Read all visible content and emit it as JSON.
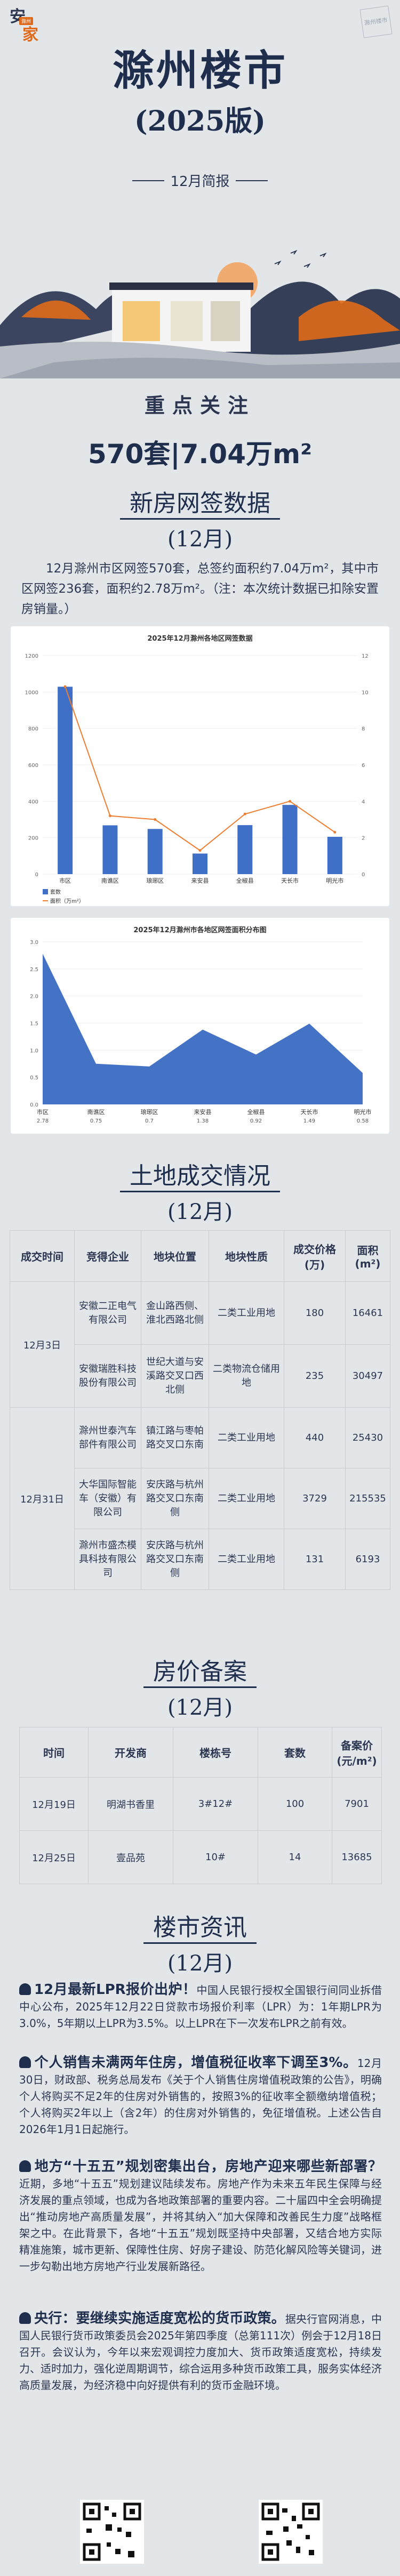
{
  "header": {
    "logo_char1": "安",
    "logo_char2": "家",
    "logo_sub": "滁州",
    "corner_logo": "滁州楼市",
    "title": "滁州楼市",
    "subtitle": "(2025版)",
    "brief": "12月简报",
    "focus": "重点关注",
    "headline": "570套|7.04万m²"
  },
  "newhouse": {
    "title": "新房网签数据",
    "period": "(12月)",
    "paragraph": "12月滁州市区网签570套，总签约面积约7.04万m²，其中市区网签236套，面积约2.78万m²。（注：本次统计数据已扣除安置房销量。）"
  },
  "chart_data": [
    {
      "type": "bar",
      "title": "2025年12月滁州各地区网签数据",
      "categories": [
        "市区",
        "南谯区",
        "琅琊区",
        "来安县",
        "全椒县",
        "天长市",
        "明光市"
      ],
      "series": [
        {
          "name": "套数",
          "values": [
            1029,
            268,
            248,
            113,
            269,
            380,
            205
          ]
        },
        {
          "name": "面积（万m²）",
          "values": [
            10.3,
            3.2,
            3.0,
            1.3,
            3.3,
            4.0,
            2.3
          ]
        }
      ],
      "legend": "bottom-left"
    },
    {
      "type": "area",
      "title": "2025年12月滁州市各地区网签面积分布图",
      "categories": [
        "市区",
        "南谯区",
        "琅琊区",
        "来安县",
        "全椒县",
        "天长市",
        "明光市"
      ],
      "values": [
        2.78,
        0.75,
        0.7,
        1.38,
        0.92,
        1.49,
        0.58
      ]
    }
  ],
  "land": {
    "title": "土地成交情况",
    "period": "(12月)",
    "headers": [
      "成交时间",
      "竞得企业",
      "地块位置",
      "地块性质",
      "成交价格(万)",
      "面积(m²)"
    ],
    "rows": [
      [
        "12月3日",
        "安徽二正电气有限公司",
        "金山路西侧、淮北西路北侧",
        "二类工业用地",
        "180",
        "16461"
      ],
      [
        "",
        "安徽瑞胜科技股份有限公司",
        "世纪大道与安溪路交叉口西北侧",
        "二类物流仓储用地",
        "235",
        "30497"
      ],
      [
        "12月31日",
        "滁州世泰汽车部件有限公司",
        "镇江路与枣帕路交叉口东南",
        "二类工业用地",
        "440",
        "25430"
      ],
      [
        "",
        "大华国际智能车（安徽）有限公司",
        "安庆路与杭州路交叉口东南侧",
        "二类工业用地",
        "3729",
        "215535"
      ],
      [
        "",
        "滁州市盛杰模具科技有限公司",
        "安庆路与杭州路交叉口东南侧",
        "二类工业用地",
        "131",
        "6193"
      ]
    ]
  },
  "filing": {
    "title": "房价备案",
    "period": "(12月)",
    "headers": [
      "时间",
      "开发商",
      "楼栋号",
      "套数",
      "备案价(元/m²)"
    ],
    "rows": [
      [
        "12月19日",
        "明湖书香里",
        "3#12#",
        "100",
        "7901"
      ],
      [
        "12月25日",
        "壹品苑",
        "10#",
        "14",
        "13685"
      ]
    ]
  },
  "news": {
    "title": "楼市资讯",
    "period": "(12月)",
    "items": [
      {
        "head": "12月最新LPR报价出炉！",
        "body": "中国人民银行授权全国银行间同业拆借中心公布，2025年12月22日贷款市场报价利率（LPR）为：1年期LPR为3.0%，5年期以上LPR为3.5%。以上LPR在下一次发布LPR之前有效。"
      },
      {
        "head": "个人销售未满两年住房，增值税征收率下调至3%。",
        "body": "12月30日，财政部、税务总局发布《关于个人销售住房增值税政策的公告》，明确个人将购买不足2年的住房对外销售的，按照3%的征收率全额缴纳增值税；个人将购买2年以上（含2年）的住房对外销售的，免征增值税。上述公告自2026年1月1日起施行。"
      },
      {
        "head": "地方“十五五”规划密集出台，房地产迎来哪些新部署？",
        "body": "近期，多地“十五五”规划建议陆续发布。房地产作为未来五年民生保障与经济发展的重点领域，也成为各地政策部署的重要内容。二十届四中全会明确提出“推动房地产高质量发展”，并将其纳入“加大保障和改善民生力度”战略框架之中。在此背景下，各地“十五五”规划既坚持中央部署，又结合地方实际精准施策，城市更新、保障性住房、好房子建设、防范化解风险等关键词，进一步勾勒出地方房地产行业发展新路径。"
      },
      {
        "head": "央行：要继续实施适度宽松的货币政策。",
        "body": "据央行官网消息，中国人民银行货币政策委员会2025年第四季度（总第111次）例会于12月18日召开。会议认为，今年以来宏观调控力度加大、货币政策适度宽松，持续发力、适时加力，强化逆周期调节，综合运用多种货币政策工具，服务实体经济高质量发展，为经济稳中向好提供有利的货币金融环境。"
      }
    ]
  },
  "colors": {
    "navy": "#1f2e4d",
    "accent": "#e06a1a",
    "bar": "#3f6fc6",
    "line": "#ed7d31",
    "bg": "#e3e6e9"
  }
}
